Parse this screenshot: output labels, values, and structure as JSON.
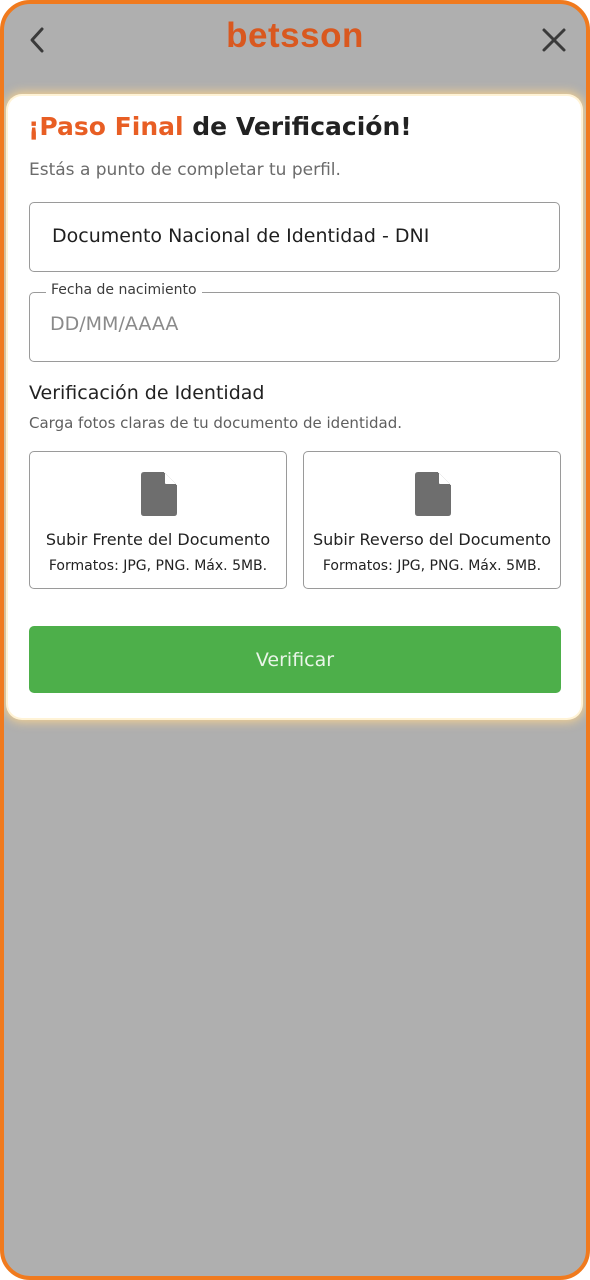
{
  "header": {
    "brand": "betsson",
    "back_icon": "chevron-left-icon",
    "close_icon": "close-icon"
  },
  "card": {
    "title_accent": "¡Paso Final",
    "title_rest": " de Verificación!",
    "subtitle": "Estás a punto de completar tu perfil."
  },
  "form": {
    "document_type": {
      "value": "Documento Nacional de Identidad - DNI"
    },
    "birthdate": {
      "label": "Fecha de nacimiento",
      "placeholder": "DD/MM/AAAA",
      "value": ""
    }
  },
  "verification": {
    "title": "Verificación de Identidad",
    "subtitle": "Carga fotos claras de tu documento de identidad.",
    "uploads": [
      {
        "label": "Subir Frente del Documento",
        "formats": "Formatos: JPG, PNG. Máx. 5MB.",
        "icon": "document-icon"
      },
      {
        "label": "Subir Reverso del Documento",
        "formats": "Formatos: JPG, PNG. Máx. 5MB.",
        "icon": "document-icon"
      }
    ]
  },
  "submit": {
    "label": "Verificar"
  },
  "colors": {
    "brand_orange": "#d9581f",
    "accent_orange": "#e85e24",
    "frame_border": "#f07a1e",
    "backdrop": "#afafaf",
    "button_green": "#4daf4a",
    "icon_gray": "#6e6e6e"
  }
}
